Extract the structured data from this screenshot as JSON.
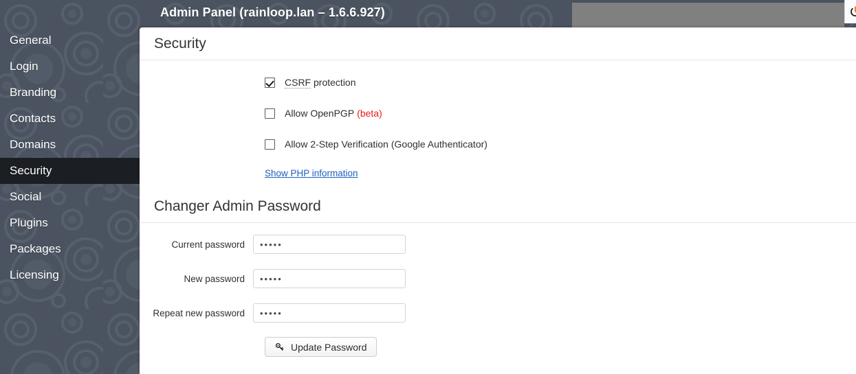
{
  "header": {
    "title": "Admin Panel  (rainloop.lan – 1.6.6.927)",
    "logout_icon": "power-icon",
    "redacted_field": ""
  },
  "sidebar": {
    "items": [
      {
        "label": "General",
        "active": false
      },
      {
        "label": "Login",
        "active": false
      },
      {
        "label": "Branding",
        "active": false
      },
      {
        "label": "Contacts",
        "active": false
      },
      {
        "label": "Domains",
        "active": false
      },
      {
        "label": "Security",
        "active": true
      },
      {
        "label": "Social",
        "active": false
      },
      {
        "label": "Plugins",
        "active": false
      },
      {
        "label": "Packages",
        "active": false
      },
      {
        "label": "Licensing",
        "active": false
      }
    ]
  },
  "security": {
    "title": "Security",
    "checkboxes": [
      {
        "label_pre": "CSRF",
        "label_post": " protection",
        "checked": true,
        "dotted": true,
        "beta": ""
      },
      {
        "label_pre": "",
        "label_post": "Allow OpenPGP",
        "checked": false,
        "dotted": false,
        "beta": "(beta)"
      },
      {
        "label_pre": "",
        "label_post": "Allow 2-Step Verification (Google Authenticator)",
        "checked": false,
        "dotted": false,
        "beta": ""
      }
    ],
    "php_link": "Show PHP information"
  },
  "password": {
    "title": "Changer Admin Password",
    "fields": [
      {
        "label": "Current password",
        "value": "•••••",
        "placeholder": ""
      },
      {
        "label": "New password",
        "value": "•••••",
        "placeholder": ""
      },
      {
        "label": "Repeat new password",
        "value": "•••••",
        "placeholder": ""
      }
    ],
    "submit_label": "Update Password",
    "submit_icon": "key-icon"
  },
  "colors": {
    "app_background": "#4a535f",
    "sidebar_active": "#1b1e23",
    "content_background": "#ffffff",
    "link": "#1f5fbf",
    "beta": "#e31b1b",
    "redaction": "#808080"
  }
}
